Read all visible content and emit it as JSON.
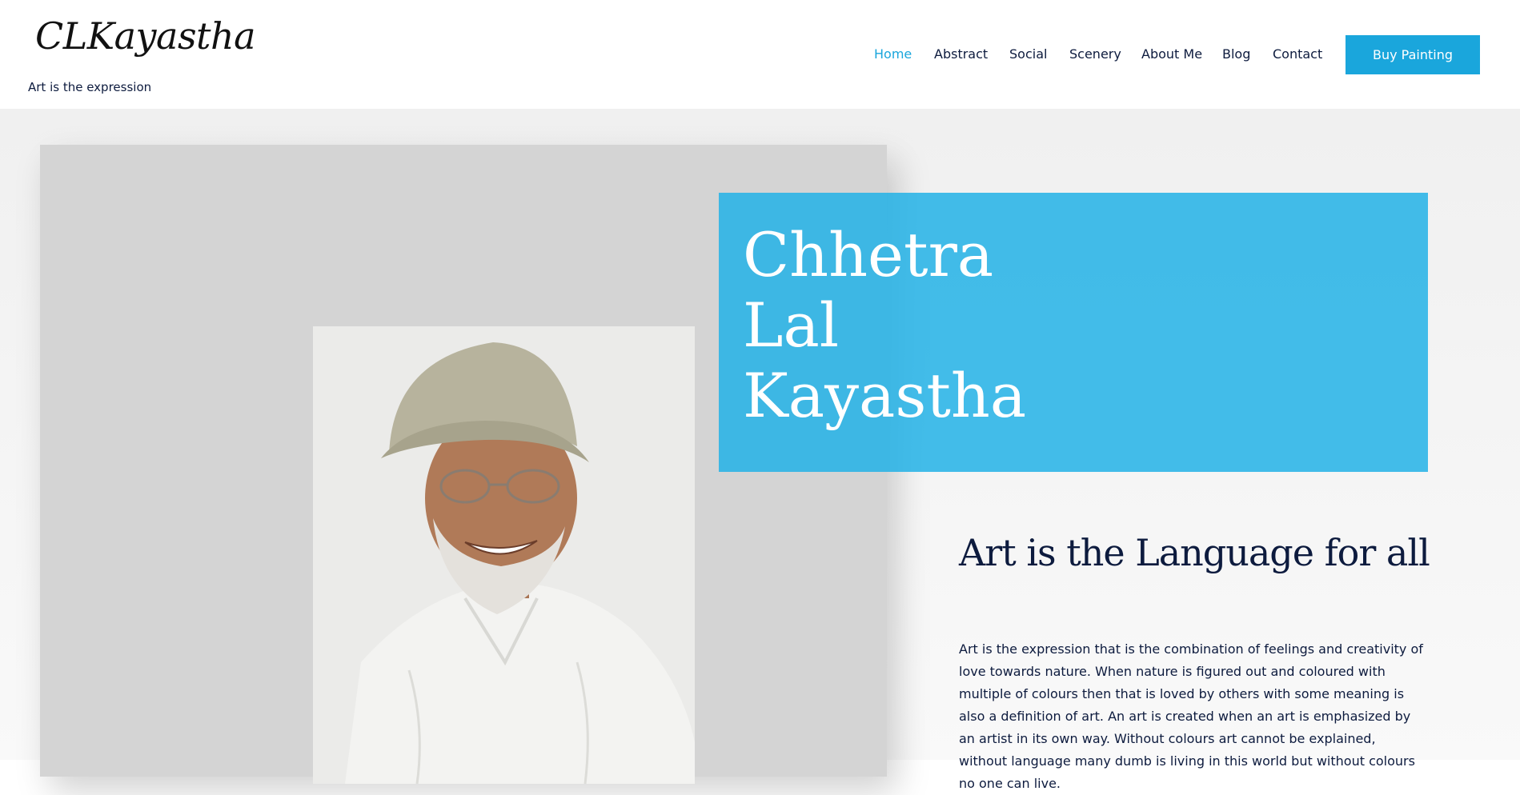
{
  "site": {
    "logo": "CLKayastha",
    "tagline": "Art is the expression"
  },
  "nav": {
    "items": [
      "Home",
      "Abstract",
      "Social",
      "Scenery",
      "About Me",
      "Blog",
      "Contact"
    ],
    "active": "Home",
    "cta_label": "Buy Painting"
  },
  "colors": {
    "accent": "#1aa6dc",
    "text": "#0d1b3e"
  },
  "hero": {
    "name_lines": [
      "Chhetra",
      "Lal",
      "Kayastha"
    ],
    "headline": "Art is the Language for all",
    "paragraph": "Art is the expression that is the combination of feelings and creativity of love towards nature. When nature is figured out and coloured with multiple of colours then that is loved by others with some meaning is also a definition of art. An art is created when an art is emphasized by an artist in its own way. Without colours art cannot be explained, without language many dumb is living in this world but without colours no one can live."
  }
}
